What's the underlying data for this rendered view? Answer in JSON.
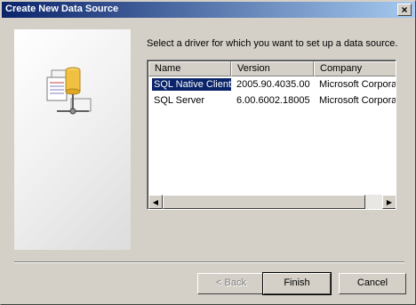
{
  "window": {
    "title": "Create New Data Source",
    "close_glyph": "×"
  },
  "instruction": "Select a driver for which you want to set up a data source.",
  "list": {
    "columns": [
      "Name",
      "Version",
      "Company"
    ],
    "rows": [
      {
        "name": "SQL Native Client",
        "version": "2005.90.4035.00",
        "company": "Microsoft Corporation",
        "selected": true
      },
      {
        "name": "SQL Server",
        "version": "6.00.6002.18005",
        "company": "Microsoft Corporation",
        "selected": false
      }
    ]
  },
  "scrollbar": {
    "left_arrow": "◀",
    "right_arrow": "▶"
  },
  "buttons": {
    "back": "< Back",
    "finish": "Finish",
    "cancel": "Cancel"
  },
  "colors": {
    "title_start": "#0a246a",
    "title_end": "#a6caf0",
    "selection": "#0a246a",
    "face": "#d4d0c8"
  },
  "icons": {
    "side_logo": "odbc-data-source-icon",
    "close": "close-icon"
  }
}
